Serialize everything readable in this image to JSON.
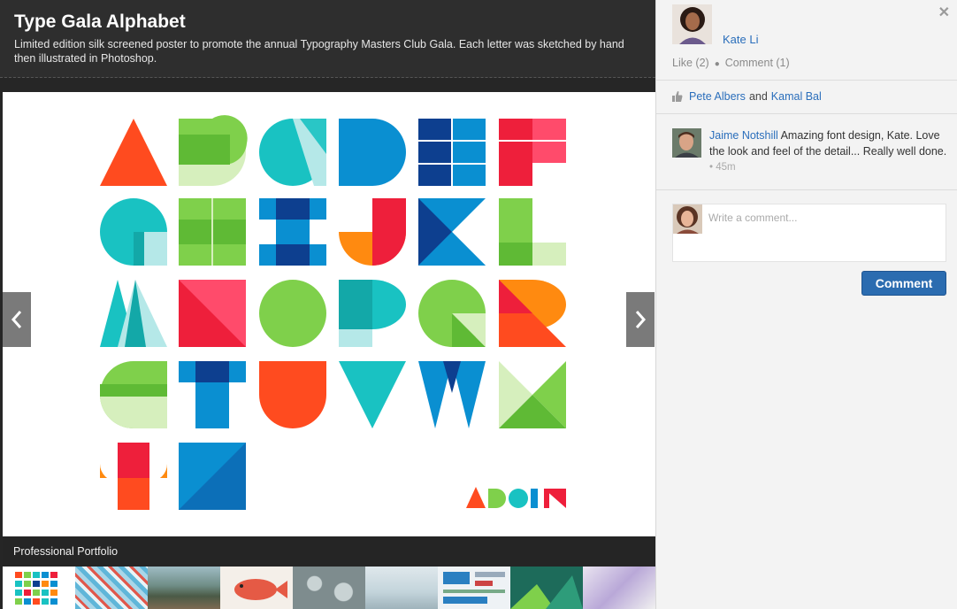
{
  "project": {
    "title": "Type Gala Alphabet",
    "description": "Limited edition silk screened poster to promote the annual Typography Masters Club Gala. Each letter was sketched by hand then illustrated in Photoshop."
  },
  "viewer": {
    "prev_icon": "chevron-left-icon",
    "next_icon": "chevron-right-icon"
  },
  "portfolio": {
    "label": "Professional Portfolio",
    "thumbnail_count": 9
  },
  "sidebar": {
    "close_icon": "close-icon",
    "author": {
      "name": "Kate Li"
    },
    "actions": {
      "like": "Like (2)",
      "comment": "Comment (1)"
    },
    "likes": {
      "names": [
        "Pete Albers",
        "Kamal Bal"
      ],
      "joiner": "and"
    },
    "comment": {
      "author": "Jaime Notshill",
      "text": " Amazing font design, Kate. Love the look and feel of the detail... Really well done.",
      "time": "45m"
    },
    "compose": {
      "placeholder": "Write a comment...",
      "button_label": "Comment"
    }
  },
  "colors": {
    "red": "#ff4b1f",
    "green": "#7fd04b",
    "teal": "#19c2c2",
    "blue": "#0a8fd1",
    "navy": "#0d3f8f",
    "crimson": "#ee1f3b",
    "orange": "#ff8a10",
    "link": "#2a6ebb"
  }
}
